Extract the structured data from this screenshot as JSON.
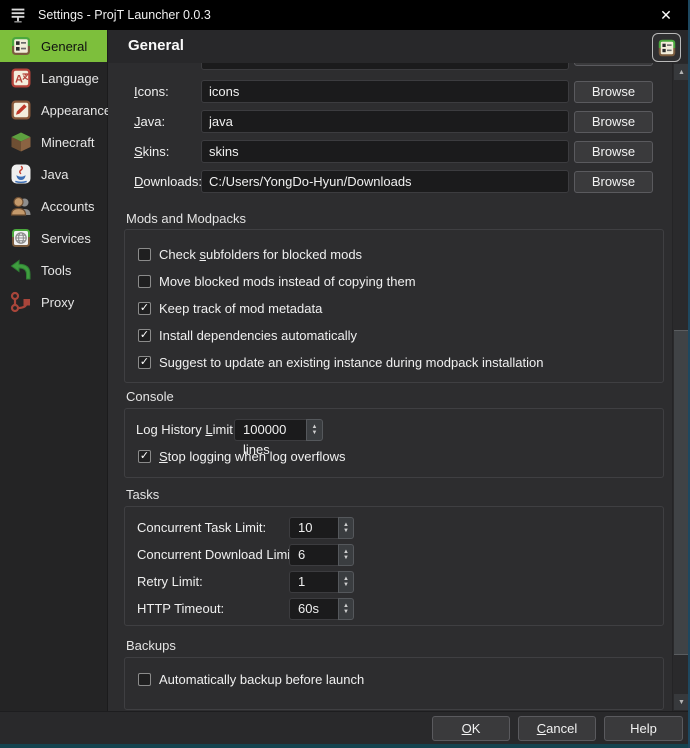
{
  "titlebar": {
    "title": "Settings - ProjT Launcher 0.0.3"
  },
  "icons": {
    "close": "✕",
    "check": "✓",
    "arrow_up": "▲",
    "arrow_down": "▼"
  },
  "sidebar": {
    "items": [
      {
        "label": "General",
        "selected": true
      },
      {
        "label": "Language",
        "selected": false
      },
      {
        "label": "Appearance",
        "selected": false
      },
      {
        "label": "Minecraft",
        "selected": false
      },
      {
        "label": "Java",
        "selected": false
      },
      {
        "label": "Accounts",
        "selected": false
      },
      {
        "label": "Services",
        "selected": false
      },
      {
        "label": "Tools",
        "selected": false
      },
      {
        "label": "Proxy",
        "selected": false
      }
    ]
  },
  "header": {
    "title": "General"
  },
  "labels": {
    "browse": "Browse"
  },
  "folders": {
    "rows": [
      {
        "pre": "",
        "mn": "I",
        "post": "cons:",
        "value": "icons"
      },
      {
        "pre": "",
        "mn": "J",
        "post": "ava:",
        "value": "java"
      },
      {
        "pre": "",
        "mn": "S",
        "post": "kins:",
        "value": "skins"
      },
      {
        "pre": "",
        "mn": "D",
        "post": "ownloads:",
        "value": "C:/Users/YongDo-Hyun/Downloads"
      }
    ]
  },
  "mods": {
    "title": "Mods and Modpacks",
    "checks": [
      {
        "pre": "Check ",
        "mn": "s",
        "post": "ubfolders for blocked mods",
        "checked": false
      },
      {
        "pre": "",
        "mn": "",
        "post": "Move blocked mods instead of copying them",
        "checked": false
      },
      {
        "pre": "",
        "mn": "",
        "post": "Keep track of mod metadata",
        "checked": true
      },
      {
        "pre": "",
        "mn": "",
        "post": "Install dependencies automatically",
        "checked": true
      },
      {
        "pre": "",
        "mn": "",
        "post": "Suggest to update an existing instance during modpack installation",
        "checked": true
      }
    ]
  },
  "console": {
    "title": "Console",
    "log_limit": {
      "pre": "Log History ",
      "mn": "L",
      "post": "imit:",
      "value": "100000 lines"
    },
    "stop_logging": {
      "pre": "",
      "mn": "S",
      "post": "top logging when log overflows",
      "checked": true
    }
  },
  "tasks": {
    "title": "Tasks",
    "rows": [
      {
        "label": "Concurrent Task Limit:",
        "value": "10"
      },
      {
        "label": "Concurrent Download Limit:",
        "value": "6"
      },
      {
        "label": "Retry Limit:",
        "value": "1"
      },
      {
        "label": "HTTP Timeout:",
        "value": "60s"
      }
    ]
  },
  "backups": {
    "title": "Backups",
    "check": {
      "pre": "",
      "mn": "",
      "post": "Automatically backup before launch",
      "checked": false
    }
  },
  "footer": {
    "ok": {
      "pre": "",
      "mn": "O",
      "post": "K"
    },
    "cancel": {
      "pre": "",
      "mn": "C",
      "post": "ancel"
    },
    "help": "Help"
  }
}
